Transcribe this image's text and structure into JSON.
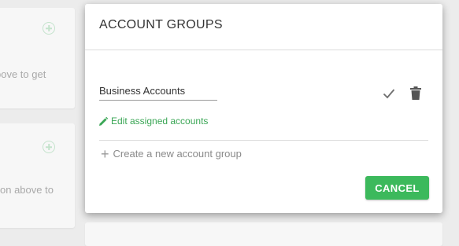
{
  "background_cards": [
    {
      "fragment": "bove to get"
    },
    {
      "fragment": "on above to"
    }
  ],
  "modal": {
    "title": "ACCOUNT GROUPS",
    "group": {
      "name": "Business Accounts",
      "edit_link": "Edit assigned accounts"
    },
    "create_link": "Create a new account group",
    "cancel_label": "CANCEL"
  },
  "colors": {
    "accent_green": "#3cb95c",
    "link_green": "#3aa655"
  },
  "icons": [
    "plus-circle-icon",
    "check-icon",
    "trash-icon",
    "pencil-icon",
    "plus-icon"
  ]
}
